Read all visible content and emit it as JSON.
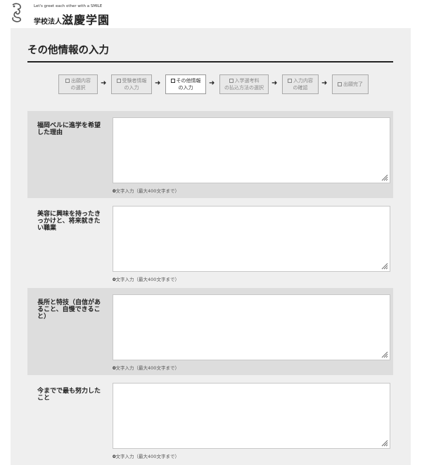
{
  "header": {
    "tagline": "Let's greet each other with a SMILE",
    "school_prefix": "学校法人",
    "school_name": "滋慶学園"
  },
  "page": {
    "title": "その他情報の入力"
  },
  "steps": [
    {
      "line1": "出願内容",
      "line2": "の選択",
      "active": false
    },
    {
      "line1": "受験者情報",
      "line2": "の入力",
      "active": false
    },
    {
      "line1": "その他情報",
      "line2": "の入力",
      "active": true
    },
    {
      "line1": "入学選考料",
      "line2": "の払込方法の選択",
      "active": false
    },
    {
      "line1": "入力内容",
      "line2": "の確認",
      "active": false
    },
    {
      "line1": "出願完了",
      "line2": "",
      "active": false
    }
  ],
  "fields": [
    {
      "label": "福岡ベルに進学を希望した理由",
      "count_value": "0",
      "count_text": "文字入力（最大400文字まで）",
      "value": ""
    },
    {
      "label": "美容に興味を持ったきっかけと、将来就きたい職業",
      "count_value": "0",
      "count_text": "文字入力（最大400文字まで）",
      "value": ""
    },
    {
      "label": "長所と特技（自信があること、自慢できること）",
      "count_value": "0",
      "count_text": "文字入力（最大400文字まで）",
      "value": ""
    },
    {
      "label": "今までで最も努力したこと",
      "count_value": "0",
      "count_text": "文字入力（最大400文字まで）",
      "value": ""
    }
  ]
}
